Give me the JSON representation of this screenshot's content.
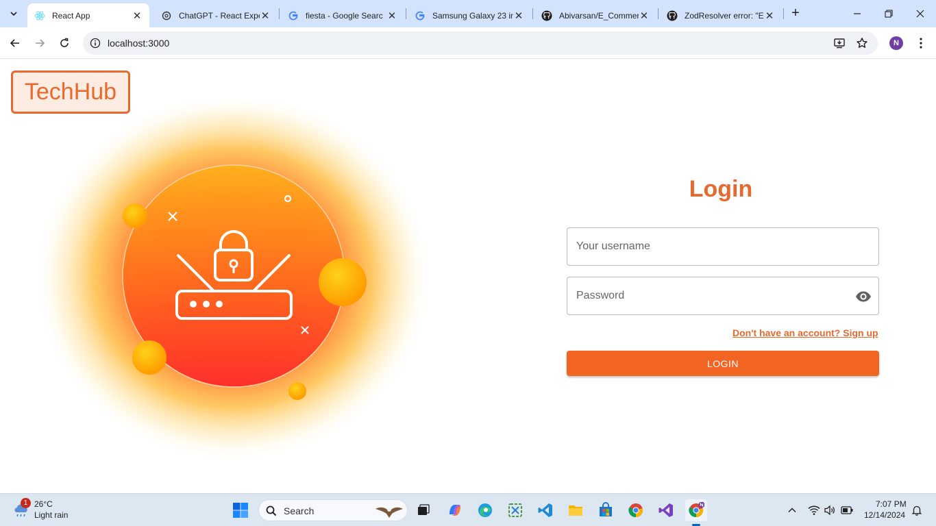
{
  "browser": {
    "tabs": [
      {
        "title": "React App",
        "icon": "react-icon",
        "active": true
      },
      {
        "title": "ChatGPT - React Expe",
        "icon": "chatgpt-icon",
        "active": false
      },
      {
        "title": "fiesta - Google Searc",
        "icon": "google-icon",
        "active": false
      },
      {
        "title": "Samsung Galaxy 23 in",
        "icon": "google-icon",
        "active": false
      },
      {
        "title": "Abivarsan/E_Commer",
        "icon": "github-icon",
        "active": false
      },
      {
        "title": "ZodResolver error: \"E",
        "icon": "github-icon",
        "active": false
      }
    ],
    "url": "localhost:3000",
    "profile_initial": "N"
  },
  "app": {
    "logo": "TechHub",
    "login_title": "Login",
    "username_placeholder": "Your username",
    "password_placeholder": "Password",
    "signup_link": "Don't have an account? Sign up",
    "login_button": "LOGIN",
    "colors": {
      "accent": "#e8692e",
      "button": "#f26422"
    }
  },
  "taskbar": {
    "weather": {
      "temp": "26°C",
      "desc": "Light rain",
      "badge": "1"
    },
    "search_label": "Search",
    "clock_time": "7:07 PM",
    "clock_date": "12/14/2024"
  }
}
